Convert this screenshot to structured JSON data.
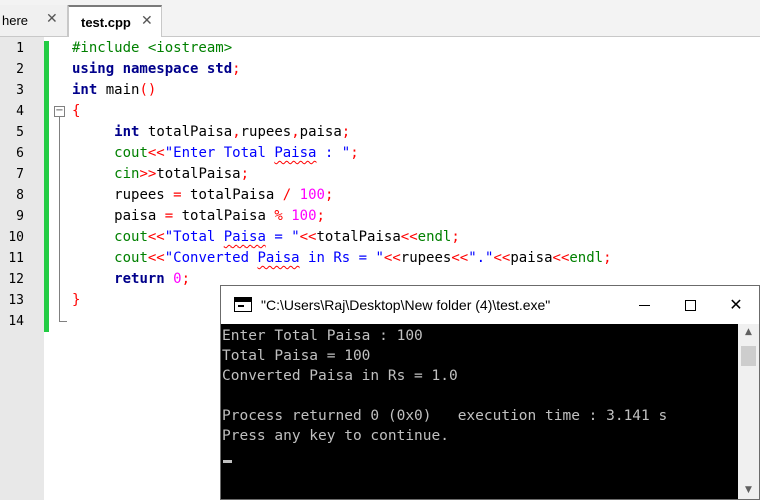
{
  "tabs": [
    {
      "label": "here",
      "close": "✕"
    },
    {
      "label": "test.cpp",
      "close": "✕"
    }
  ],
  "line_numbers": [
    "1",
    "2",
    "3",
    "4",
    "5",
    "6",
    "7",
    "8",
    "9",
    "10",
    "11",
    "12",
    "13",
    "14"
  ],
  "fold_marker": "−",
  "console": {
    "title": "\"C:\\Users\\Raj\\Desktop\\New folder (4)\\test.exe\"",
    "lines": [
      "Enter Total Paisa : 100",
      "Total Paisa = 100",
      "Converted Paisa in Rs = 1.0",
      "",
      "Process returned 0 (0x0)   execution time : 3.141 s",
      "Press any key to continue."
    ],
    "buttons": {
      "close": "✕"
    },
    "scroll_up": "▲",
    "scroll_down": "▼"
  },
  "icons": {
    "tab_close": "close-icon",
    "console": "console-app-icon"
  },
  "colors": {
    "change_bar": "#22cc44",
    "keyword": "#00008b",
    "string": "#0000ff",
    "number": "#ff00ff",
    "operator": "#ff0000",
    "preprocessor": "#008000"
  }
}
